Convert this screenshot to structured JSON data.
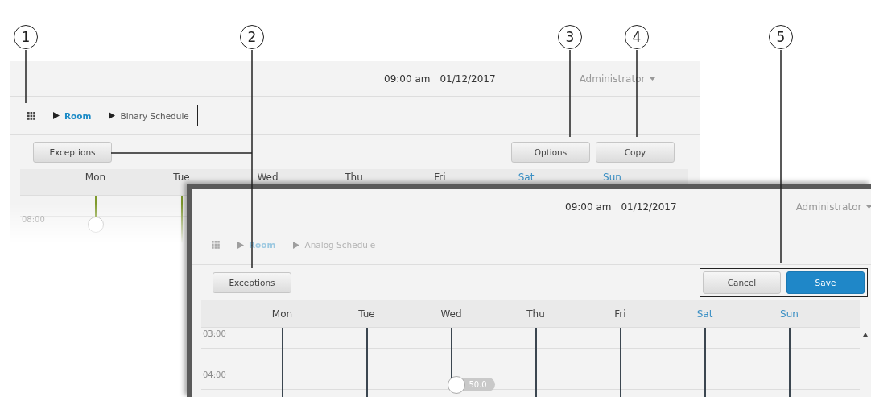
{
  "callouts": [
    "1",
    "2",
    "3",
    "4",
    "5"
  ],
  "back_screen": {
    "time": "09:00 am",
    "date": "01/12/2017",
    "user": "Administrator",
    "breadcrumb": {
      "highlighted": true,
      "disabled": false,
      "items": [
        {
          "label": "Room",
          "selected": true
        },
        {
          "label": "Binary Schedule",
          "selected": false
        }
      ]
    },
    "left_buttons": [
      {
        "label": "Exceptions",
        "kind": "default"
      }
    ],
    "right_buttons": {
      "highlighted": false,
      "items": [
        {
          "label": "Options",
          "kind": "default"
        },
        {
          "label": "Copy",
          "kind": "default"
        }
      ]
    },
    "days": [
      {
        "label": "Mon",
        "weekend": false,
        "handle": true
      },
      {
        "label": "Tue",
        "weekend": false,
        "handle": false
      },
      {
        "label": "Wed",
        "weekend": false,
        "handle": false
      },
      {
        "label": "Thu",
        "weekend": false,
        "handle": false
      },
      {
        "label": "Fri",
        "weekend": false,
        "handle": false
      },
      {
        "label": "Sat",
        "weekend": true,
        "handle": false
      },
      {
        "label": "Sun",
        "weekend": true,
        "handle": false
      }
    ],
    "time_labels": [
      "08:00"
    ]
  },
  "front_screen": {
    "time": "09:00 am",
    "date": "01/12/2017",
    "user": "Administrator",
    "breadcrumb": {
      "highlighted": false,
      "disabled": true,
      "items": [
        {
          "label": "Room",
          "selected": true
        },
        {
          "label": "Analog Schedule",
          "selected": false
        }
      ]
    },
    "left_buttons": [
      {
        "label": "Exceptions",
        "kind": "default"
      }
    ],
    "right_buttons": {
      "highlighted": true,
      "items": [
        {
          "label": "Cancel",
          "kind": "default"
        },
        {
          "label": "Save",
          "kind": "primary"
        }
      ]
    },
    "days": [
      {
        "label": "Mon",
        "weekend": false,
        "handle": false
      },
      {
        "label": "Tue",
        "weekend": false,
        "handle": false
      },
      {
        "label": "Wed",
        "weekend": false,
        "handle": true,
        "handle_label": "50.0"
      },
      {
        "label": "Thu",
        "weekend": false,
        "handle": false
      },
      {
        "label": "Fri",
        "weekend": false,
        "handle": false
      },
      {
        "label": "Sat",
        "weekend": true,
        "handle": false
      },
      {
        "label": "Sun",
        "weekend": true,
        "handle": false
      }
    ],
    "time_labels": [
      "03:00",
      "04:00"
    ]
  }
}
